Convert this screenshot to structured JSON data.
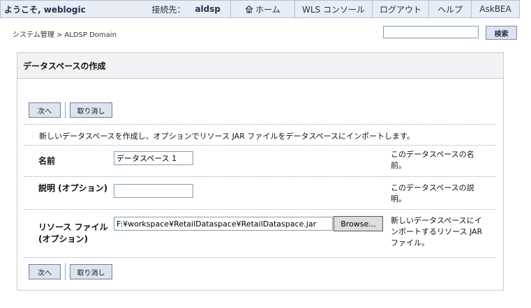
{
  "header": {
    "welcome": "ようこそ, weblogic",
    "connect_label": "接続先：",
    "server": "aldsp",
    "nav": {
      "home": "ホーム",
      "wls": "WLS コンソール",
      "logout": "ログアウト",
      "help": "ヘルプ",
      "ask": "AskBEA"
    }
  },
  "breadcrumb": "システム管理 > ALDSP Domain",
  "search": {
    "value": "",
    "button_label": "検索"
  },
  "panel": {
    "title": "データスペースの作成",
    "next_label": "次へ",
    "cancel_label": "取り消し",
    "description": "新しいデータスペースを作成し、オプションでリソース JAR ファイルをデータスペースにインポートします。"
  },
  "form": {
    "name": {
      "label": "名前",
      "value": "データスペース 1",
      "hint": "このデータスペースの名前。"
    },
    "description": {
      "label": "説明 (オプション)",
      "value": "",
      "hint": "このデータスペースの説明。"
    },
    "resource": {
      "label": "リソース ファイル (オプション)",
      "value": "F:¥workspace¥RetailDataspace¥RetailDataspace.jar",
      "browse_label": "Browse...",
      "hint": "新しいデータスペースにインポートするリソース JAR ファイル。"
    }
  },
  "colors": {
    "header_bg": "#e8ecf4",
    "header_text": "#23324f",
    "button_bg": "#dde3ef"
  }
}
